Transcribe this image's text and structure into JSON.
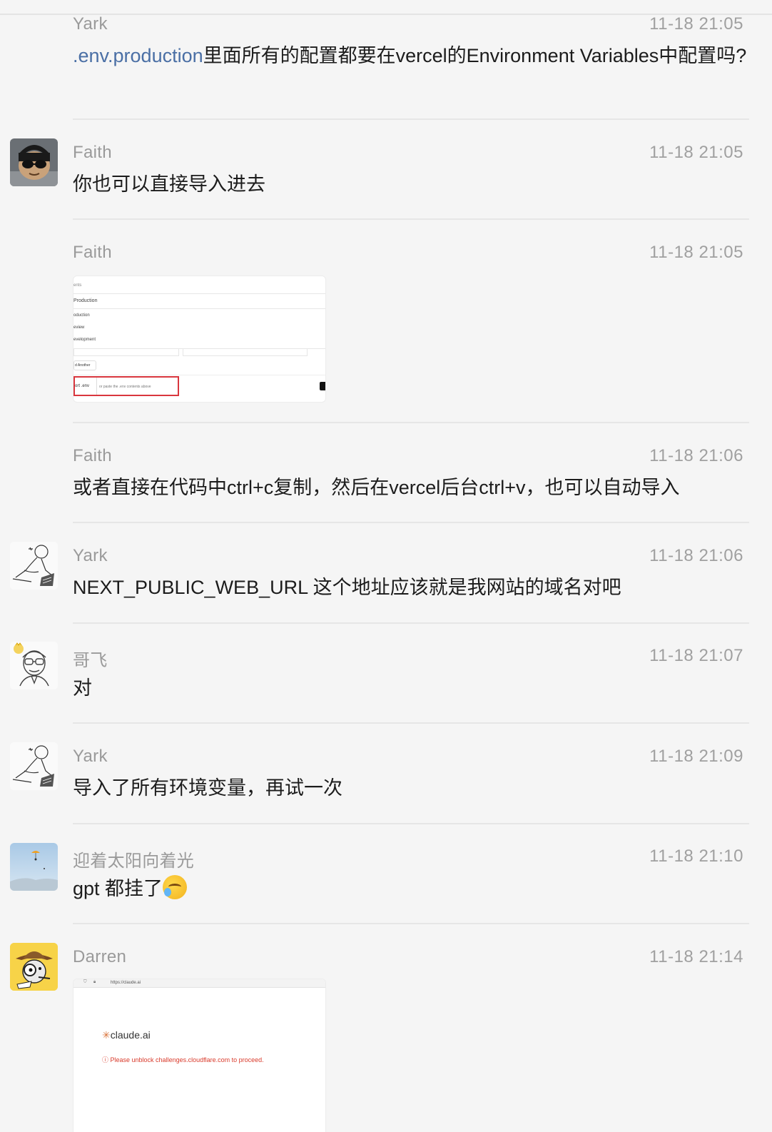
{
  "messages": [
    {
      "name": "Yark",
      "time": "11-18 21:05",
      "text_link": ".env.production",
      "text": "里面所有的配置都要在vercel的Environment Variables中配置吗?"
    },
    {
      "name": "Faith",
      "time": "11-18 21:05",
      "text": "你也可以直接导入进去"
    },
    {
      "name": "Faith",
      "time": "11-18 21:05",
      "image": {
        "l1": "ents",
        "l2": "Production",
        "l3": "oduction",
        "l4": "eview",
        "l5": "evelopment",
        "l6": "d Another",
        "l7": "ort .env",
        "l8": "or paste the .env contents above"
      }
    },
    {
      "name": "Faith",
      "time": "11-18 21:06",
      "text": "或者直接在代码中ctrl+c复制，然后在vercel后台ctrl+v，也可以自动导入"
    },
    {
      "name": "Yark",
      "time": "11-18 21:06",
      "text": "NEXT_PUBLIC_WEB_URL 这个地址应该就是我网站的域名对吧"
    },
    {
      "name": "哥飞",
      "time": "11-18 21:07",
      "text": "对"
    },
    {
      "name": "Yark",
      "time": "11-18 21:09",
      "text": "导入了所有环境变量，再试一次"
    },
    {
      "name": "迎着太阳向着光",
      "time": "11-18 21:10",
      "text": "gpt 都挂了"
    },
    {
      "name": "Darren",
      "time": "11-18 21:14",
      "image": {
        "url": "https://claude.ai",
        "brand": "claude.ai",
        "error": "Please unblock challenges.cloudflare.com to proceed."
      }
    }
  ],
  "colors": {
    "link": "#4a6fa5",
    "name": "#9a9a9a",
    "error": "#d93a2b"
  }
}
